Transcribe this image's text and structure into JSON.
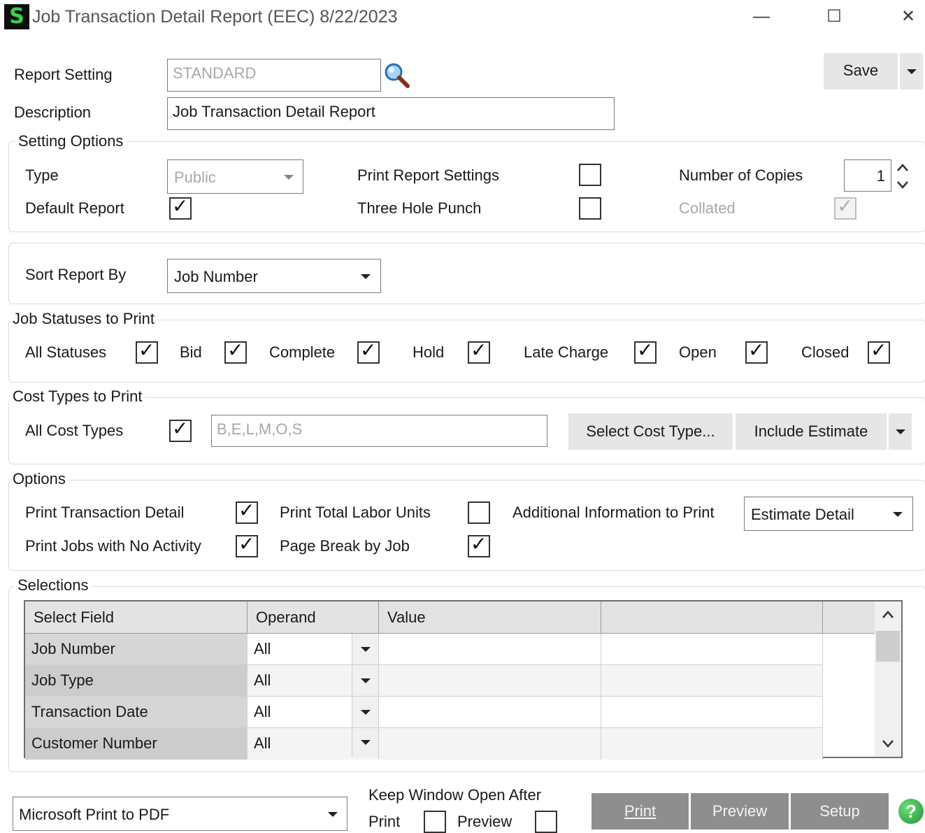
{
  "window": {
    "logo": "S",
    "title": "Job Transaction Detail Report (EEC) 8/22/2023",
    "minimize": "—",
    "maximize": "☐",
    "close": "✕"
  },
  "report": {
    "setting_label": "Report Setting",
    "setting_value": "STANDARD",
    "description_label": "Description",
    "description_value": "Job Transaction Detail Report",
    "save_label": "Save"
  },
  "setting_options": {
    "legend": "Setting Options",
    "type_label": "Type",
    "type_value": "Public",
    "default_report_label": "Default Report",
    "default_report_checked": true,
    "print_report_settings_label": "Print Report Settings",
    "print_report_settings_checked": false,
    "three_hole_punch_label": "Three Hole Punch",
    "three_hole_punch_checked": false,
    "copies_label": "Number of Copies",
    "copies_value": "1",
    "collated_label": "Collated",
    "collated_checked": true
  },
  "sort": {
    "label": "Sort Report By",
    "value": "Job Number"
  },
  "statuses": {
    "legend": "Job Statuses to Print",
    "items": [
      {
        "label": "All Statuses",
        "checked": true
      },
      {
        "label": "Bid",
        "checked": true
      },
      {
        "label": "Complete",
        "checked": true
      },
      {
        "label": "Hold",
        "checked": true
      },
      {
        "label": "Late Charge",
        "checked": true
      },
      {
        "label": "Open",
        "checked": true
      },
      {
        "label": "Closed",
        "checked": true
      }
    ]
  },
  "cost_types": {
    "legend": "Cost Types to Print",
    "all_label": "All Cost Types",
    "all_checked": true,
    "value": "B,E,L,M,O,S",
    "select_button": "Select Cost Type...",
    "include_estimate": "Include Estimate"
  },
  "options": {
    "legend": "Options",
    "print_transaction_detail": "Print Transaction Detail",
    "print_total_labor_units": "Print Total Labor Units",
    "additional_info_label": "Additional Information to Print",
    "additional_info_value": "Estimate Detail",
    "print_jobs_no_activity": "Print Jobs with No Activity",
    "page_break_by_job": "Page Break by Job",
    "checks": {
      "transaction_detail": true,
      "total_labor_units": false,
      "jobs_no_activity": true,
      "page_break": true
    }
  },
  "selections": {
    "legend": "Selections",
    "columns": [
      "Select Field",
      "Operand",
      "Value",
      ""
    ],
    "rows": [
      {
        "field": "Job Number",
        "operand": "All",
        "value": "",
        "extra": ""
      },
      {
        "field": "Job Type",
        "operand": "All",
        "value": "",
        "extra": ""
      },
      {
        "field": "Transaction Date",
        "operand": "All",
        "value": "",
        "extra": ""
      },
      {
        "field": "Customer Number",
        "operand": "All",
        "value": "",
        "extra": ""
      }
    ]
  },
  "footer": {
    "printer": "Microsoft Print to PDF",
    "keep_open_label": "Keep Window Open After",
    "print_label": "Print",
    "preview_label": "Preview",
    "print_checked": false,
    "preview_checked": false,
    "btn_print": "Print",
    "btn_preview": "Preview",
    "btn_setup": "Setup",
    "help": "?"
  },
  "colors": {
    "accent_logo": "#3bd14a",
    "button_dark": "#8e8e8e",
    "help_green": "#1f8e35"
  }
}
